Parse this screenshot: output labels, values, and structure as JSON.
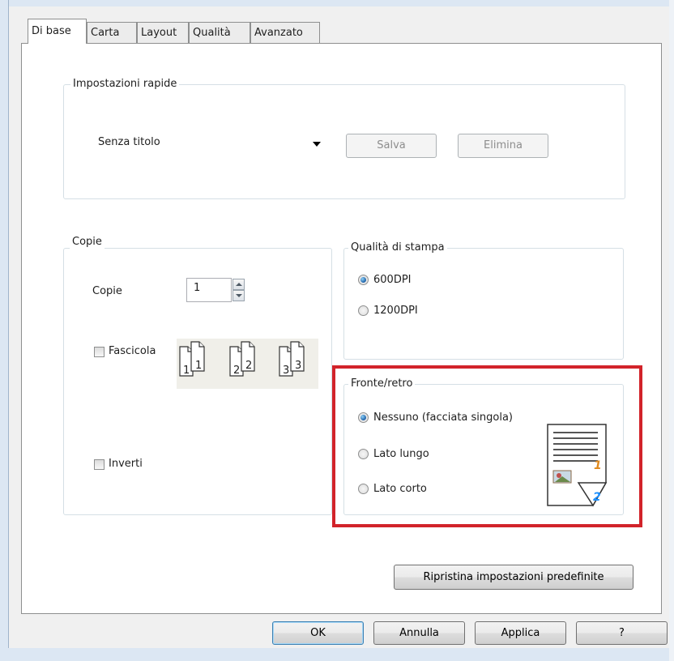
{
  "tabs": [
    {
      "label": "Di base",
      "active": true
    },
    {
      "label": "Carta",
      "active": false
    },
    {
      "label": "Layout",
      "active": false
    },
    {
      "label": "Qualità",
      "active": false
    },
    {
      "label": "Avanzato",
      "active": false
    }
  ],
  "quick_settings": {
    "title": "Impostazioni rapide",
    "preset_value": "Senza titolo",
    "save_label": "Salva",
    "delete_label": "Elimina"
  },
  "copies": {
    "title": "Copie",
    "copies_label": "Copie",
    "copies_value": "1",
    "collate_label": "Fascicola",
    "collate_checked": false,
    "collate_pages": [
      "1",
      "2",
      "3"
    ],
    "reverse_label": "Inverti",
    "reverse_checked": false
  },
  "print_quality": {
    "title": "Qualità di stampa",
    "options": [
      {
        "label": "600DPI",
        "checked": true
      },
      {
        "label": "1200DPI",
        "checked": false
      }
    ]
  },
  "duplex": {
    "title": "Fronte/retro",
    "options": [
      {
        "label": "Nessuno (facciata singola)",
        "checked": true
      },
      {
        "label": "Lato lungo",
        "checked": false
      },
      {
        "label": "Lato corto",
        "checked": false
      }
    ],
    "preview_page_numbers": [
      "1",
      "2"
    ]
  },
  "restore_defaults_label": "Ripristina impostazioni predefinite",
  "footer": {
    "ok_label": "OK",
    "cancel_label": "Annulla",
    "apply_label": "Applica",
    "help_label": "?"
  },
  "colors": {
    "highlight": "#d2232a",
    "radio_selected": "#1c5fa6",
    "group_border": "#d5dfe5"
  }
}
